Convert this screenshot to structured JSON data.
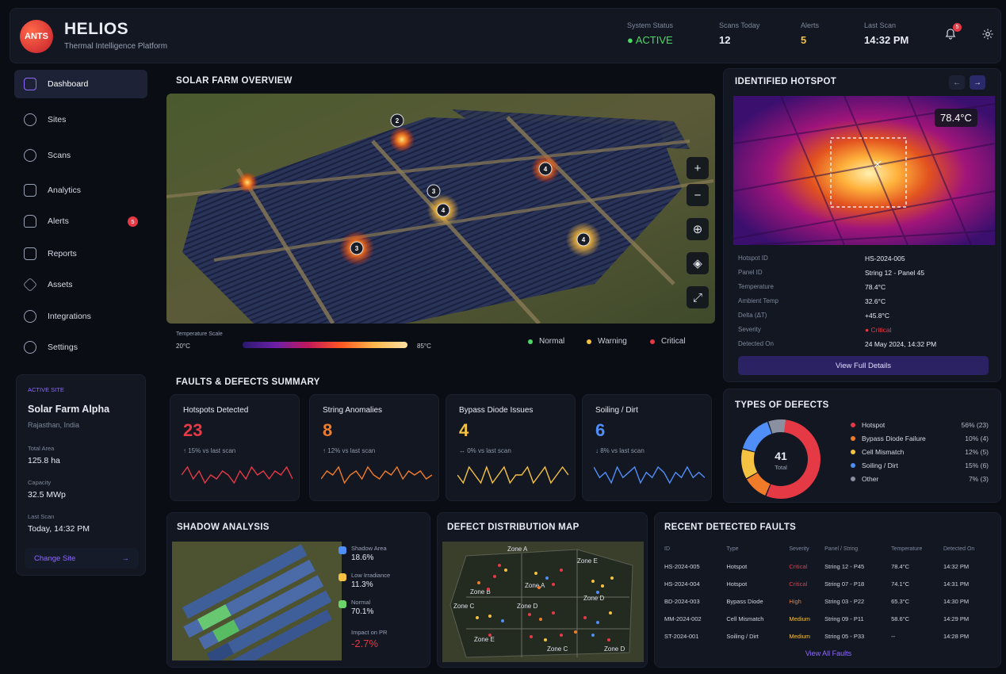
{
  "header": {
    "logo_text": "ANTS",
    "app_name": "HELIOS",
    "app_subtitle": "Thermal Intelligence Platform",
    "stats": [
      {
        "label": "System Status",
        "value": "● ACTIVE",
        "color": "#4cd964"
      },
      {
        "label": "Scans Today",
        "value": "12",
        "color": "#e8ebf2"
      },
      {
        "label": "Alerts",
        "value": "5",
        "color": "#f5c242"
      },
      {
        "label": "Last Scan",
        "value": "14:32 PM",
        "color": "#e8ebf2"
      }
    ],
    "notification_count": "5"
  },
  "sidebar": {
    "items": [
      {
        "label": "Dashboard",
        "icon": "dashboard-icon",
        "active": true
      },
      {
        "label": "Sites",
        "icon": "sites-icon"
      },
      {
        "label": "Scans",
        "icon": "scans-icon"
      },
      {
        "label": "Analytics",
        "icon": "analytics-icon"
      },
      {
        "label": "Alerts",
        "icon": "bell-icon",
        "badge": "5"
      },
      {
        "label": "Reports",
        "icon": "reports-icon"
      },
      {
        "label": "Assets",
        "icon": "assets-icon"
      },
      {
        "label": "Integrations",
        "icon": "integrations-icon"
      },
      {
        "label": "Settings",
        "icon": "gear-icon"
      }
    ]
  },
  "active_site": {
    "heading": "ACTIVE SITE",
    "name": "Solar Farm Alpha",
    "location": "Rajasthan, India",
    "total_area_label": "Total Area",
    "total_area": "125.8 ha",
    "capacity_label": "Capacity",
    "capacity": "32.5 MWp",
    "last_scan_label": "Last Scan",
    "last_scan": "Today, 14:32 PM",
    "change_label": "Change Site",
    "change_arrow": "→"
  },
  "overview": {
    "title": "SOLAR FARM OVERVIEW",
    "markers": [
      "2",
      "4",
      "3",
      "4",
      "3",
      "4"
    ],
    "scale_label": "Temperature Scale",
    "scale_min": "20°C",
    "scale_max": "85°C",
    "legend": [
      {
        "label": "Normal",
        "color": "#4cd964"
      },
      {
        "label": "Warning",
        "color": "#f5c242"
      },
      {
        "label": "Critical",
        "color": "#e63946"
      }
    ],
    "controls": [
      "+",
      "−",
      "⊕",
      "◈",
      "⤢"
    ]
  },
  "hotspot": {
    "title": "IDENTIFIED HOTSPOT",
    "temp_badge": "78.4°C",
    "rows": [
      {
        "k": "Hotspot ID",
        "v": "HS-2024-005"
      },
      {
        "k": "Panel ID",
        "v": "String 12 - Panel 45"
      },
      {
        "k": "Temperature",
        "v": "78.4°C"
      },
      {
        "k": "Ambient Temp",
        "v": "32.6°C"
      },
      {
        "k": "Delta (ΔT)",
        "v": "+45.8°C"
      },
      {
        "k": "Severity",
        "v": "● Critical"
      },
      {
        "k": "Detected On",
        "v": "24 May 2024, 14:32 PM"
      }
    ],
    "button_label": "View Full Details",
    "prev": "←",
    "next": "→"
  },
  "faults": {
    "title": "FAULTS & DEFECTS SUMMARY",
    "cards": [
      {
        "title": "Hotspots Detected",
        "value": "23",
        "delta": "↑ 15% vs last scan",
        "color": "#e63946",
        "spark": [
          5,
          7,
          4,
          6,
          3,
          5,
          4,
          6,
          5,
          3,
          6,
          4,
          7,
          5,
          6,
          4,
          6,
          5,
          7,
          4
        ]
      },
      {
        "title": "String Anomalies",
        "value": "8",
        "delta": "↑ 12% vs last scan",
        "color": "#f07c2a",
        "spark": [
          4,
          6,
          5,
          7,
          3,
          5,
          6,
          4,
          7,
          5,
          4,
          6,
          5,
          7,
          4,
          6,
          5,
          6,
          4,
          5
        ]
      },
      {
        "title": "Bypass Diode Issues",
        "value": "4",
        "delta": "↔ 0% vs last scan",
        "color": "#f5c242",
        "spark": [
          5,
          4,
          6,
          5,
          4,
          6,
          4,
          5,
          6,
          4,
          5,
          5,
          6,
          4,
          5,
          6,
          4,
          5,
          6,
          5
        ]
      },
      {
        "title": "Soiling / Dirt",
        "value": "6",
        "delta": "↓ 8% vs last scan",
        "color": "#4f8ff7",
        "spark": [
          6,
          4,
          5,
          3,
          6,
          4,
          5,
          6,
          3,
          5,
          4,
          6,
          5,
          3,
          5,
          4,
          6,
          4,
          5,
          4
        ]
      }
    ]
  },
  "types": {
    "title": "TYPES OF DEFECTS",
    "total": "41",
    "total_label": "Total",
    "items": [
      {
        "label": "Hotspot",
        "pct": "56% (23)",
        "value": 56,
        "color": "#e63946"
      },
      {
        "label": "Bypass Diode Failure",
        "pct": "10% (4)",
        "value": 10,
        "color": "#f07c2a"
      },
      {
        "label": "Cell Mismatch",
        "pct": "12% (5)",
        "value": 12,
        "color": "#f5c242"
      },
      {
        "label": "Soiling / Dirt",
        "pct": "15% (6)",
        "value": 15,
        "color": "#4f8ff7"
      },
      {
        "label": "Other",
        "pct": "7% (3)",
        "value": 7,
        "color": "#8a90a0"
      }
    ]
  },
  "shadow": {
    "title": "SHADOW ANALYSIS",
    "legend": [
      {
        "label": "Shadow Area",
        "value": "18.6%",
        "color": "#4f8ff7"
      },
      {
        "label": "Low Irradiance",
        "value": "11.3%",
        "color": "#f5c242"
      },
      {
        "label": "Normal",
        "value": "70.1%",
        "color": "#6ad36a"
      }
    ],
    "impact_label": "Impact on PR",
    "impact_value": "-2.7%"
  },
  "distmap": {
    "title": "DEFECT DISTRIBUTION MAP",
    "zones": [
      "Zone A",
      "Zone E",
      "Zone B",
      "Zone A",
      "Zone D",
      "Zone C",
      "Zone D",
      "Zone E",
      "Zone C",
      "Zone D"
    ]
  },
  "recent": {
    "title": "RECENT DETECTED FAULTS",
    "headers": [
      "ID",
      "Type",
      "Severity",
      "Panel / String",
      "Temperature",
      "Detected On"
    ],
    "rows": [
      [
        "HS-2024-005",
        "Hotspot",
        "Critical",
        "String 12 - P45",
        "78.4°C",
        "14:32 PM"
      ],
      [
        "HS-2024-004",
        "Hotspot",
        "Critical",
        "String 07 - P18",
        "74.1°C",
        "14:31 PM"
      ],
      [
        "BD-2024-003",
        "Bypass Diode",
        "High",
        "String 03 - P22",
        "65.3°C",
        "14:30 PM"
      ],
      [
        "MM-2024-002",
        "Cell Mismatch",
        "Medium",
        "String 09 - P11",
        "58.6°C",
        "14:29 PM"
      ],
      [
        "ST-2024-001",
        "Soiling / Dirt",
        "Medium",
        "String 05 - P33",
        "--",
        "14:28 PM"
      ]
    ],
    "severity_colors": {
      "Critical": "#e63946",
      "High": "#f07c2a",
      "Medium": "#f5c242"
    },
    "view_all": "View All Faults"
  }
}
